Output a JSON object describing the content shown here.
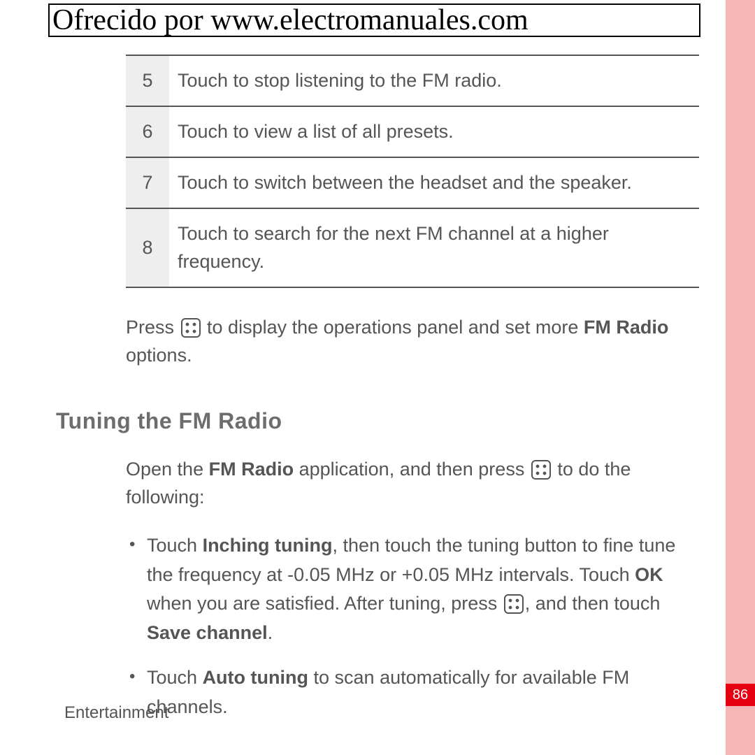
{
  "header": {
    "text": "Ofrecido por www.electromanuales.com"
  },
  "steps": [
    {
      "n": "5",
      "text": "Touch to stop listening to the FM radio."
    },
    {
      "n": "6",
      "text": "Touch to view a list of all presets."
    },
    {
      "n": "7",
      "text": "Touch to switch between the headset and the speaker."
    },
    {
      "n": "8",
      "text": "Touch to search for the next FM channel at a higher frequency."
    }
  ],
  "press_sentence": {
    "pre": "Press ",
    "mid": " to display the operations panel and set more ",
    "bold": "FM Radio",
    "post": " options."
  },
  "section_heading": "Tuning the FM Radio",
  "open_sentence": {
    "pre": "Open the ",
    "bold": "FM Radio",
    "mid": " application, and then press ",
    "post": " to do the following:"
  },
  "bullet1": {
    "t1": "Touch ",
    "b1": "Inching tuning",
    "t2": ", then touch the tuning button to fine tune the frequency at -0.05 MHz or +0.05 MHz intervals. Touch ",
    "b2": "OK",
    "t3": " when you are satisfied. After tuning, press ",
    "t4": ", and then touch ",
    "b3": "Save channel",
    "t5": "."
  },
  "bullet2": {
    "t1": "Touch ",
    "b1": "Auto tuning",
    "t2": " to scan automatically for available FM channels."
  },
  "footer": {
    "label": "Entertainment",
    "page": "86"
  }
}
